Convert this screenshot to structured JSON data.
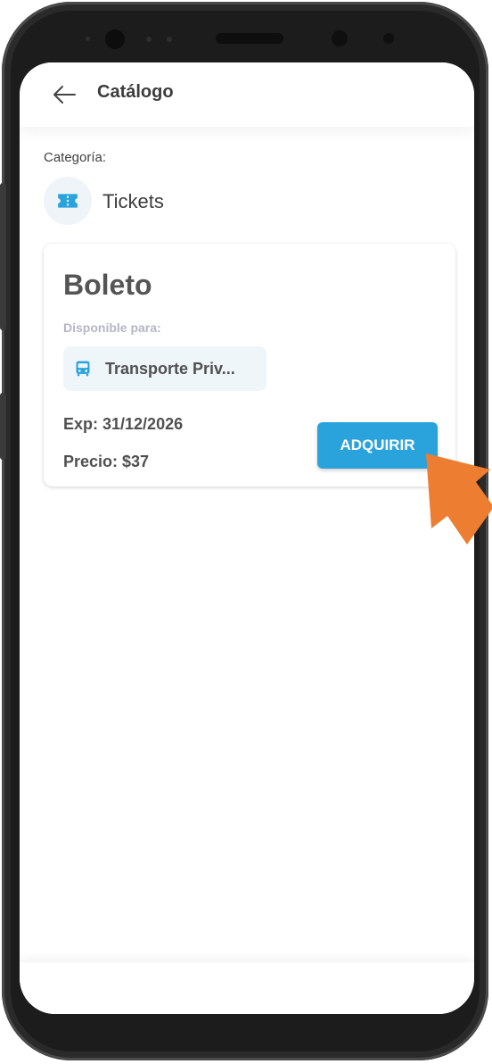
{
  "header": {
    "back_icon": "arrow-left-icon",
    "title": "Catálogo"
  },
  "category": {
    "label": "Categoría:",
    "icon": "ticket-icon",
    "name": "Tickets"
  },
  "card": {
    "title": "Boleto",
    "available_label": "Disponible para:",
    "chip_icon": "bus-icon",
    "chip_text": "Transporte Priv...",
    "expiry": "Exp: 31/12/2026",
    "price": "Precio: $37",
    "buy_label": "ADQUIRIR"
  },
  "colors": {
    "accent": "#2aa3dd",
    "pointer": "#ed7d31"
  }
}
